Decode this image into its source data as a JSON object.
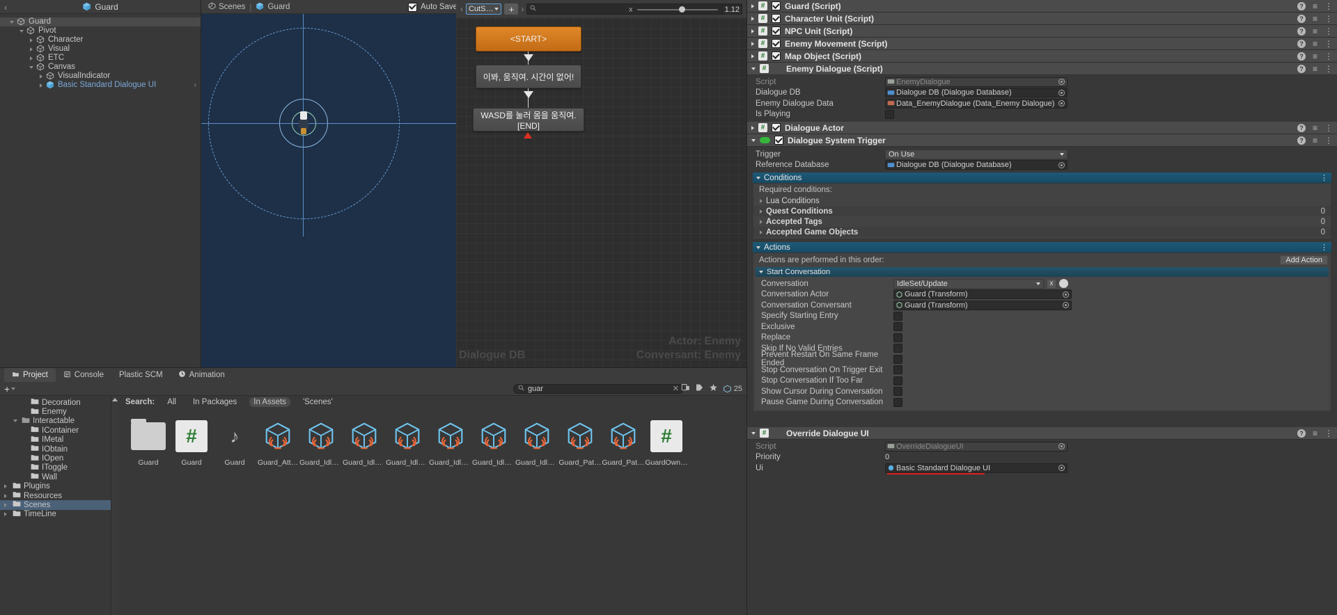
{
  "hierarchy": {
    "title": "Guard",
    "back_icon": "back-chevron-icon",
    "items": [
      {
        "label": "Guard",
        "depth": 0,
        "expanded": true,
        "selected": true,
        "blue": false
      },
      {
        "label": "Pivot",
        "depth": 1,
        "expanded": true,
        "selected": false,
        "blue": false
      },
      {
        "label": "Character",
        "depth": 2,
        "expanded": false,
        "selected": false,
        "blue": false
      },
      {
        "label": "Visual",
        "depth": 2,
        "expanded": false,
        "selected": false,
        "blue": false
      },
      {
        "label": "ETC",
        "depth": 2,
        "expanded": false,
        "selected": false,
        "blue": false
      },
      {
        "label": "Canvas",
        "depth": 2,
        "expanded": true,
        "selected": false,
        "blue": false
      },
      {
        "label": "VisualIndicator",
        "depth": 3,
        "expanded": false,
        "selected": false,
        "blue": false
      },
      {
        "label": "Basic Standard Dialogue UI",
        "depth": 3,
        "expanded": false,
        "selected": false,
        "blue": true
      }
    ]
  },
  "scene": {
    "tab_scenes": "Scenes",
    "tab_guard": "Guard",
    "separator": "|",
    "autosave_label": "Auto Save",
    "autosave_checked": true
  },
  "dialogue_editor": {
    "conversation_dropdown": "CutS…",
    "add_button": "+",
    "search_placeholder": "",
    "search_icon": "search-icon",
    "zoom_value": "1.12",
    "clear_icon": "x",
    "nodes": [
      {
        "id": "start",
        "label": "<START>",
        "type": "start"
      },
      {
        "id": "n1",
        "label": "이봐, 움직여. 시간이 없어!",
        "type": "dialogue"
      },
      {
        "id": "n2",
        "label": "WASD를 눌러 몸을 움직여. [END]",
        "type": "dialogue"
      }
    ],
    "watermark": "Dialogue DB",
    "actor_line": "Actor: Enemy",
    "conversant_line": "Conversant: Enemy"
  },
  "inspector": {
    "components": [
      {
        "name": "Guard (Script)",
        "icon": "script-icon",
        "enabled": true,
        "expanded": false
      },
      {
        "name": "Character Unit (Script)",
        "icon": "script-icon",
        "enabled": true,
        "expanded": false
      },
      {
        "name": "NPC Unit (Script)",
        "icon": "script-icon",
        "enabled": true,
        "expanded": false
      },
      {
        "name": "Enemy Movement (Script)",
        "icon": "script-icon",
        "enabled": true,
        "expanded": false
      },
      {
        "name": "Map Object (Script)",
        "icon": "script-icon",
        "enabled": true,
        "expanded": false
      },
      {
        "name": "Enemy Dialogue (Script)",
        "icon": "script-icon",
        "enabled": null,
        "expanded": true
      }
    ],
    "enemy_dialogue": {
      "fields": [
        {
          "label": "Script",
          "value": "EnemyDialogue",
          "type": "object",
          "disabled": true,
          "icon": "script-asset-icon"
        },
        {
          "label": "Dialogue DB",
          "value": "Dialogue DB (Dialogue Database)",
          "type": "object",
          "disabled": false,
          "icon": "database-icon"
        },
        {
          "label": "Enemy Dialogue Data",
          "value": "Data_EnemyDialogue (Data_Enemy Dialogue)",
          "type": "object",
          "disabled": false,
          "icon": "scriptableobject-icon"
        },
        {
          "label": "Is Playing",
          "value": "",
          "type": "checkbox",
          "checked": false
        }
      ]
    },
    "dialogue_actor": {
      "name": "Dialogue Actor",
      "enabled": true,
      "expanded": false,
      "icon": "script-icon"
    },
    "dialogue_system_trigger": {
      "name": "Dialogue System Trigger",
      "enabled": true,
      "expanded": true,
      "icon": "green-pill-icon",
      "trigger_label": "Trigger",
      "trigger_value": "On Use",
      "reference_db_label": "Reference Database",
      "reference_db_value": "Dialogue DB (Dialogue Database)",
      "conditions": {
        "header": "Conditions",
        "required_label": "Required conditions:",
        "rows": [
          {
            "label": "Lua Conditions",
            "count": ""
          },
          {
            "label": "Quest Conditions",
            "count": "0"
          },
          {
            "label": "Accepted Tags",
            "count": "0"
          },
          {
            "label": "Accepted Game Objects",
            "count": "0"
          }
        ]
      },
      "actions": {
        "header": "Actions",
        "order_label": "Actions are performed in this order:",
        "add_action_label": "Add Action",
        "start_conversation_header": "Start Conversation",
        "fields": [
          {
            "label": "Conversation",
            "value": "IdleSet/Update",
            "type": "dropdown"
          },
          {
            "label": "Conversation Actor",
            "value": "Guard (Transform)",
            "type": "object",
            "icon": "transform-icon"
          },
          {
            "label": "Conversation Conversant",
            "value": "Guard (Transform)",
            "type": "object",
            "icon": "transform-icon"
          },
          {
            "label": "Specify Starting Entry",
            "value": "",
            "type": "checkbox",
            "checked": false
          },
          {
            "label": "Exclusive",
            "value": "",
            "type": "checkbox",
            "checked": false
          },
          {
            "label": "Replace",
            "value": "",
            "type": "checkbox",
            "checked": false
          },
          {
            "label": "Skip If No Valid Entries",
            "value": "",
            "type": "checkbox",
            "checked": false
          },
          {
            "label": "Prevent Restart On Same Frame Ended",
            "value": "",
            "type": "checkbox",
            "checked": false
          },
          {
            "label": "Stop Conversation On Trigger Exit",
            "value": "",
            "type": "checkbox",
            "checked": false
          },
          {
            "label": "Stop Conversation If Too Far",
            "value": "",
            "type": "checkbox",
            "checked": false
          },
          {
            "label": "Show Cursor During Conversation",
            "value": "",
            "type": "checkbox",
            "checked": false
          },
          {
            "label": "Pause Game During Conversation",
            "value": "",
            "type": "checkbox",
            "checked": false
          }
        ]
      }
    },
    "override_dialogue_ui": {
      "name": "Override Dialogue UI",
      "icon": "script-icon",
      "fields": [
        {
          "label": "Script",
          "value": "OverrideDialogueUI",
          "type": "object",
          "disabled": true
        },
        {
          "label": "Priority",
          "value": "0",
          "type": "text"
        },
        {
          "label": "Ui",
          "value": "Basic Standard Dialogue UI",
          "type": "object",
          "icon": "prefab-icon",
          "underlined": true
        }
      ]
    }
  },
  "project": {
    "tabs": [
      {
        "label": "Project",
        "icon": "folder-icon",
        "active": true
      },
      {
        "label": "Console",
        "icon": "console-icon",
        "active": false
      },
      {
        "label": "Plastic SCM",
        "icon": "",
        "active": false
      },
      {
        "label": "Animation",
        "icon": "clock-icon",
        "active": false
      }
    ],
    "add_button": "+",
    "search_value": "guar",
    "search_icon": "search-icon",
    "item_count": "25",
    "tree": [
      {
        "label": "Decoration",
        "depth": 2,
        "expanded": null,
        "selected": false
      },
      {
        "label": "Enemy",
        "depth": 2,
        "expanded": null,
        "selected": false
      },
      {
        "label": "Interactable",
        "depth": 1,
        "expanded": true,
        "selected": false
      },
      {
        "label": "IContainer",
        "depth": 2,
        "expanded": null,
        "selected": false
      },
      {
        "label": "IMetal",
        "depth": 2,
        "expanded": null,
        "selected": false
      },
      {
        "label": "IObtain",
        "depth": 2,
        "expanded": null,
        "selected": false
      },
      {
        "label": "IOpen",
        "depth": 2,
        "expanded": null,
        "selected": false
      },
      {
        "label": "IToggle",
        "depth": 2,
        "expanded": null,
        "selected": false
      },
      {
        "label": "Wall",
        "depth": 2,
        "expanded": null,
        "selected": false
      },
      {
        "label": "Plugins",
        "depth": 0,
        "expanded": false,
        "selected": false
      },
      {
        "label": "Resources",
        "depth": 0,
        "expanded": false,
        "selected": false
      },
      {
        "label": "Scenes",
        "depth": 0,
        "expanded": false,
        "selected": true
      },
      {
        "label": "TimeLine",
        "depth": 0,
        "expanded": false,
        "selected": false
      }
    ],
    "filter": {
      "search_label": "Search:",
      "options": [
        {
          "label": "All",
          "active": false
        },
        {
          "label": "In Packages",
          "active": false
        },
        {
          "label": "In Assets",
          "active": true
        },
        {
          "label": "'Scenes'",
          "active": false
        }
      ]
    },
    "assets": [
      {
        "name": "Guard",
        "type": "folder"
      },
      {
        "name": "Guard",
        "type": "script"
      },
      {
        "name": "Guard",
        "type": "audio"
      },
      {
        "name": "Guard_Att…",
        "type": "prefab"
      },
      {
        "name": "Guard_Idle…",
        "type": "prefab"
      },
      {
        "name": "Guard_Idle…",
        "type": "prefab"
      },
      {
        "name": "Guard_Idle…",
        "type": "prefab"
      },
      {
        "name": "Guard_Idle…",
        "type": "prefab"
      },
      {
        "name": "Guard_Idle…",
        "type": "prefab"
      },
      {
        "name": "Guard_Idle…",
        "type": "prefab"
      },
      {
        "name": "Guard_Pat…",
        "type": "prefab"
      },
      {
        "name": "Guard_Pat…",
        "type": "prefab"
      },
      {
        "name": "GuardOwn…",
        "type": "script"
      }
    ]
  },
  "colors": {
    "accent_orange": "#d4781b",
    "accent_blue": "#1d5a78",
    "panel_bg": "#383838",
    "scene_bg": "#1d3048",
    "selection": "#4b6178",
    "red_underline": "#e02020"
  }
}
